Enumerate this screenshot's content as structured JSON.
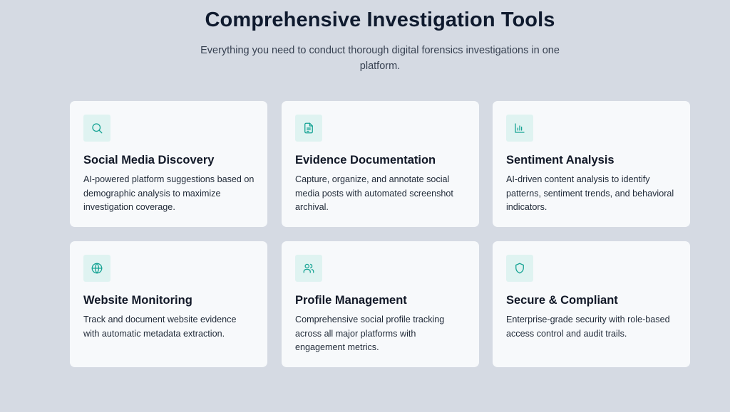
{
  "section": {
    "title": "Comprehensive Investigation Tools",
    "subtitle": "Everything you need to conduct thorough digital forensics investigations in one platform."
  },
  "accent_color": "#16a394",
  "icon_bg_color": "#dff3f1",
  "features": [
    {
      "icon": "search-icon",
      "title": "Social Media Discovery",
      "description": "AI-powered platform suggestions based on demographic analysis to maximize investigation coverage."
    },
    {
      "icon": "document-icon",
      "title": "Evidence Documentation",
      "description": "Capture, organize, and annotate social media posts with automated screenshot archival."
    },
    {
      "icon": "bar-chart-icon",
      "title": "Sentiment Analysis",
      "description": "AI-driven content analysis to identify patterns, sentiment trends, and behavioral indicators."
    },
    {
      "icon": "globe-icon",
      "title": "Website Monitoring",
      "description": "Track and document website evidence with automatic metadata extraction."
    },
    {
      "icon": "users-icon",
      "title": "Profile Management",
      "description": "Comprehensive social profile tracking across all major platforms with engagement metrics."
    },
    {
      "icon": "shield-icon",
      "title": "Secure & Compliant",
      "description": "Enterprise-grade security with role-based access control and audit trails."
    }
  ]
}
